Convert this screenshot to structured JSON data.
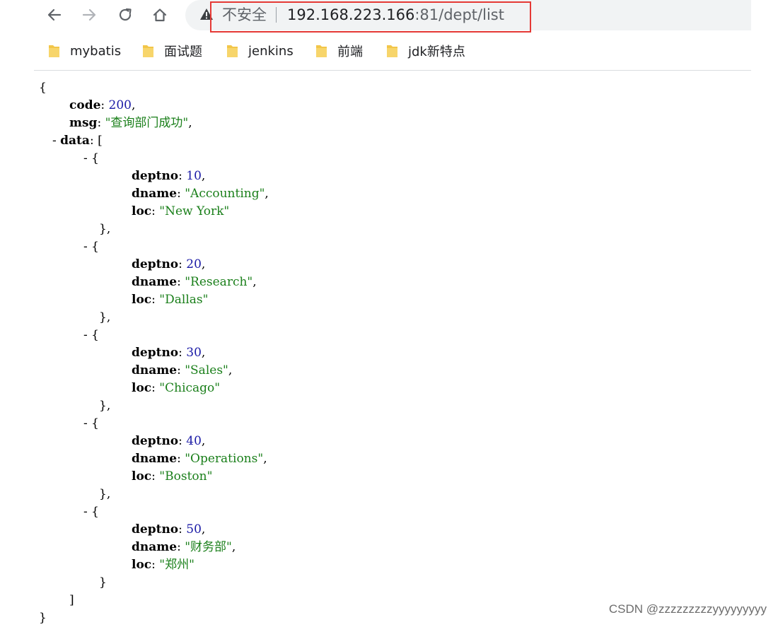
{
  "browser": {
    "security_label": "不安全",
    "url_host": "192.168.223.166",
    "url_rest": ":81/dept/list"
  },
  "bookmarks": [
    {
      "label": "mybatis"
    },
    {
      "label": "面试题"
    },
    {
      "label": "jenkins"
    },
    {
      "label": "前端"
    },
    {
      "label": "jdk新特点"
    }
  ],
  "json": {
    "open_brace": "{",
    "close_brace": "}",
    "code_key": "code",
    "code_value": "200",
    "msg_key": "msg",
    "msg_value": "\"查询部门成功\"",
    "data_key": "data",
    "data_open": "[",
    "data_close": "]",
    "items": [
      {
        "deptno": "10",
        "dname": "\"Accounting\"",
        "loc": "\"New York\""
      },
      {
        "deptno": "20",
        "dname": "\"Research\"",
        "loc": "\"Dallas\""
      },
      {
        "deptno": "30",
        "dname": "\"Sales\"",
        "loc": "\"Chicago\""
      },
      {
        "deptno": "40",
        "dname": "\"Operations\"",
        "loc": "\"Boston\""
      },
      {
        "deptno": "50",
        "dname": "\"财务部\"",
        "loc": "\"郑州\""
      }
    ],
    "item_keys": {
      "deptno": "deptno",
      "dname": "dname",
      "loc": "loc"
    }
  },
  "watermark": "CSDN @zzzzzzzzzyyyyyyyyy",
  "colors": {
    "url_highlight": "#e53935",
    "number": "#1a1aa6",
    "string": "#1a7f1a",
    "folder": "#f2c649"
  }
}
